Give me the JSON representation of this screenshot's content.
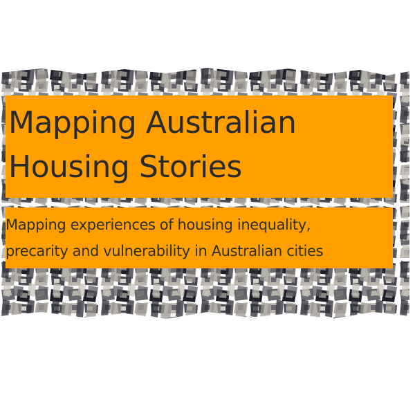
{
  "banner": {
    "image_icon": "aerial-housing-image",
    "title_lines": [
      "Mapping Australian",
      "Housing Stories"
    ],
    "subtitle_lines": [
      "Mapping experiences of housing inequality,",
      "precarity and vulnerability in Australian cities"
    ],
    "colors": {
      "box": "#ffa000",
      "text": "#2a2a2a",
      "roof_dark": "#1f1f2b",
      "roof_mid": "#6a6a6e",
      "roof_light": "#b9b4ad"
    }
  }
}
